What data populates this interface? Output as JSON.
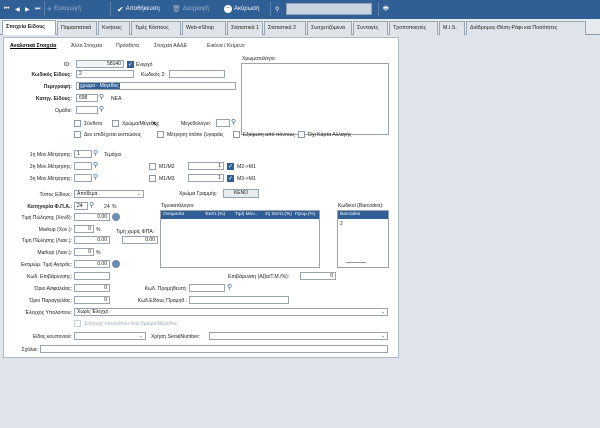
{
  "toolbar": {
    "insert_label": "Εισαγωγή",
    "save_label": "Αποθήκευση",
    "delete_label": "Διαγραφή",
    "cancel_label": "Ακύρωση"
  },
  "tabs": [
    "Στοιχεία Είδους",
    "Παραστατικά",
    "Κινήσεις",
    "Τιμές Κόστους",
    "Web-eShop",
    "Στατιστικά 1",
    "Στατιστικά 2",
    "Συσχετιζόμενα",
    "Συνταγές",
    "Τροποποιητές",
    "M.I.S.",
    "Διάδρομος-Θέση-Ράφι και Ποσότητες"
  ],
  "subtabs": [
    "Αναλυτικά Στοιχεία",
    "Άλλα Στοιχεία",
    "Πρόσθετα",
    "Στοιχεία ΑΑΔΕ",
    "Εικόνα / Κείμενο"
  ],
  "form": {
    "id_label": "ID:",
    "id_value": "58140",
    "active_label": "Ενεργό",
    "code_label": "Κωδικός Είδους:",
    "code_value": "2",
    "code2_label": "Κωδικός 2:",
    "description_label": "Περιγραφή:",
    "description_value": "χρώμα - Μέγεθος",
    "category_label": "Κατηγ. Είδους:",
    "category_code": "698",
    "category_name": "ΝΕΑ",
    "group_label": "Ομάδα:",
    "color_area_label": "Χρωματολόγιο:",
    "compound_label": "Σύνθετο",
    "color_size_label": "Χρώμα/Μέγεθος",
    "size_label": "Μεγεθολόγιο:",
    "no_discount_label": "Δεν επιδέχεται εκπτώσεις",
    "online_weigh_label": "Μέτρηση online ζυγαριάς",
    "points_label": "Εξαίρεση από πόντους",
    "no_card_label": "Όχι Κάρτα Αλλαγής",
    "unit1_label": "1η Μον.Μέτρησης:",
    "unit1_value": "1",
    "unit1_name": "Τεμάχιο",
    "unit2_label": "2η Μον.Μέτρησης:",
    "unit3_label": "3η Μον.Μέτρησης:",
    "m1m2_label": "Μ1/Μ2",
    "m1m3_label": "Μ1/Μ3",
    "m1m2_value": "1",
    "m1m3_value": "1",
    "m2m1_label": "Μ2->Μ1",
    "m3m1_label": "Μ3->Μ1",
    "type_label": "Τύπος Είδους:",
    "type_value": "Απόθεμα",
    "vat_cat_label": "Κατηγορία Φ.Π.Α.:",
    "vat_cat_value": "24",
    "vat_pct": "24",
    "pct_sign": "%",
    "line_color_label": "Χρώμα Γραμμής:",
    "line_color_btn": "ΚΕΝΟ",
    "price_sell_label": "Τιμή Πώλησης (Χονδ):",
    "price_sell_value": "0.00",
    "markup1_label": "Markup (Χον.):",
    "markup1_value": "0",
    "price_no_vat_label": "Τιμή χωρίς ΦΠΑ:",
    "price_retail_label": "Τιμή Πώλησης (Λιαν.):",
    "price_retail_value": "0.00",
    "price_no_vat_value": "0.00",
    "markup2_label": "Markup (Λιαν.):",
    "markup2_value": "0",
    "buy_price_label": "Εκτιμώμ. Τιμή Αγοράς:",
    "buy_price_value": "0.00",
    "pricelists_label": "Τιμοκατάλογοι:",
    "pricelist_cols": [
      "Ονομασία",
      "Έκπτ.(%)",
      "Τιμή Μον..",
      "2η Έκπτ.(%)",
      "Προμ.(%)"
    ],
    "barcodes_label": "Κωδικοί (Barcodes):",
    "barcodes_header": "Barcodes",
    "barcodes_values": [
      "2"
    ],
    "surcharge_code_label": "Κωδ. Επιβάρυνσης:",
    "surcharge_label": "Επιβάρυνση (Αξία/Τ.Μ./%):",
    "surcharge_value": "0",
    "safety_label": "Όριο Ασφαλείας:",
    "safety_value": "0",
    "supplier_code_label": "Κωδ. Προμηθευτή:",
    "reorder_label": "Όριο Παραγγελίας:",
    "reorder_value": "0",
    "supplier_item_label": "Κωδ.Είδους Προμηθ.:",
    "residual_label": "Έλεγχος Υπολοίπου:",
    "residual_value": "Χωρίς Έλεγχο",
    "residual_color_label": "Έλεγχος υπολοίπου ανά Χρώμα/Μέγεθος",
    "coupon_label": "Είδος κουπονιού:",
    "serial_label": "Χρήση SerialNumber:",
    "notes_label": "Σχόλια:"
  }
}
